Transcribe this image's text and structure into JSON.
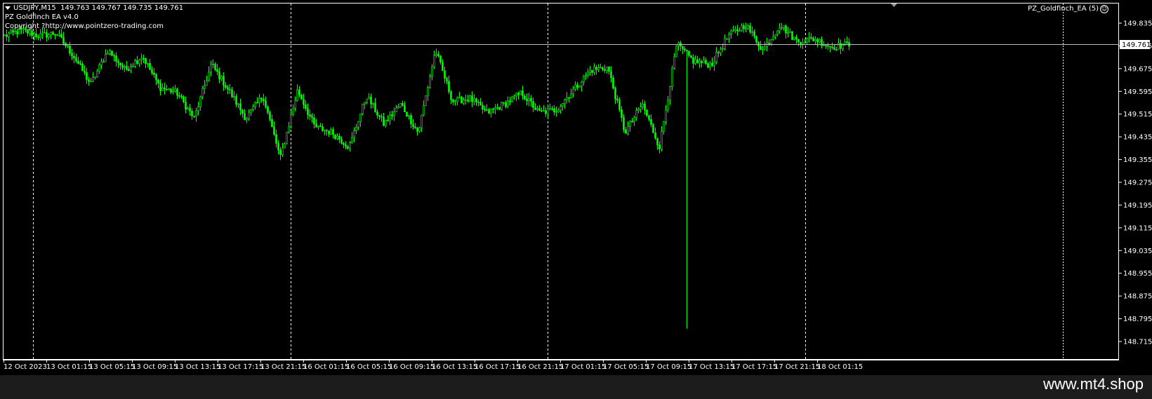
{
  "chart": {
    "symbol_timeframe": "USDJPY,M15",
    "ohlc_text": "149.763 149.767 149.735 149.761",
    "ea_name": "PZ Goldfinch EA  v4.0",
    "copyright": "Copyright ?http://www.pointzero-trading.com",
    "ea_label": "PZ_Goldfinch_EA (5)",
    "smiley_glyph": "☺",
    "current_price": "149.761",
    "colors": {
      "background": "#000000",
      "candles": "#00ff00",
      "text": "#ffffff",
      "price_line": "#c0c0c0"
    }
  },
  "price_axis": {
    "labels": [
      "149.835",
      "149.755",
      "149.675",
      "149.595",
      "149.515",
      "149.435",
      "149.355",
      "149.275",
      "149.195",
      "149.115",
      "149.035",
      "148.955",
      "148.875",
      "148.795",
      "148.715"
    ]
  },
  "time_axis": {
    "labels": [
      "12 Oct 2023",
      "13 Oct 01:15",
      "13 Oct 05:15",
      "13 Oct 09:15",
      "13 Oct 13:15",
      "13 Oct 17:15",
      "13 Oct 21:15",
      "16 Oct 01:15",
      "16 Oct 05:15",
      "16 Oct 09:15",
      "16 Oct 13:15",
      "16 Oct 17:15",
      "16 Oct 21:15",
      "17 Oct 01:15",
      "17 Oct 05:15",
      "17 Oct 09:15",
      "17 Oct 13:15",
      "17 Oct 17:15",
      "17 Oct 21:15",
      "18 Oct 01:15"
    ]
  },
  "chart_data": {
    "type": "candlestick",
    "title": "USDJPY,M15",
    "ylim": [
      148.71,
      149.88
    ],
    "price_series": [
      [
        "12 Oct 2023",
        149.79
      ],
      [
        "12 Oct 22:15",
        149.81
      ],
      [
        "13 Oct 01:15",
        149.79
      ],
      [
        "13 Oct 03:15",
        149.8
      ],
      [
        "13 Oct 05:15",
        149.72
      ],
      [
        "13 Oct 06:30",
        149.62
      ],
      [
        "13 Oct 08:00",
        149.74
      ],
      [
        "13 Oct 09:15",
        149.67
      ],
      [
        "13 Oct 11:00",
        149.72
      ],
      [
        "13 Oct 12:00",
        149.61
      ],
      [
        "13 Oct 14:30",
        149.59
      ],
      [
        "13 Oct 16:00",
        149.5
      ],
      [
        "13 Oct 17:00",
        149.69
      ],
      [
        "13 Oct 19:00",
        149.6
      ],
      [
        "13 Oct 21:15",
        149.5
      ],
      [
        "13 Oct 23:00",
        149.58
      ],
      [
        "16 Oct 00:00",
        149.36
      ],
      [
        "16 Oct 01:15",
        149.6
      ],
      [
        "16 Oct 03:00",
        149.47
      ],
      [
        "16 Oct 05:15",
        149.45
      ],
      [
        "16 Oct 07:00",
        149.4
      ],
      [
        "16 Oct 09:15",
        149.58
      ],
      [
        "16 Oct 11:15",
        149.48
      ],
      [
        "16 Oct 13:15",
        149.55
      ],
      [
        "16 Oct 14:45",
        149.45
      ],
      [
        "16 Oct 15:45",
        149.74
      ],
      [
        "16 Oct 17:15",
        149.56
      ],
      [
        "16 Oct 19:15",
        149.57
      ],
      [
        "16 Oct 21:15",
        149.52
      ],
      [
        "16 Oct 23:15",
        149.55
      ],
      [
        "17 Oct 01:15",
        149.59
      ],
      [
        "17 Oct 03:00",
        149.52
      ],
      [
        "17 Oct 05:15",
        149.53
      ],
      [
        "17 Oct 07:15",
        149.6
      ],
      [
        "17 Oct 08:45",
        149.67
      ],
      [
        "17 Oct 09:45",
        149.68
      ],
      [
        "17 Oct 10:30",
        149.45
      ],
      [
        "17 Oct 11:00",
        149.55
      ],
      [
        "17 Oct 12:00",
        149.4
      ],
      [
        "17 Oct 13:00",
        149.76
      ],
      [
        "17 Oct 14:30",
        149.7
      ],
      [
        "17 Oct 17:15",
        149.69
      ],
      [
        "17 Oct 18:30",
        149.79
      ],
      [
        "17 Oct 19:30",
        149.83
      ],
      [
        "17 Oct 20:30",
        149.74
      ],
      [
        "17 Oct 21:00",
        149.83
      ],
      [
        "17 Oct 22:30",
        149.77
      ],
      [
        "18 Oct 00:00",
        149.78
      ],
      [
        "18 Oct 01:15",
        149.75
      ],
      [
        "18 Oct 02:15",
        149.761
      ]
    ],
    "spike_low": 148.76,
    "grid": "vertical dashed separators only"
  }
}
